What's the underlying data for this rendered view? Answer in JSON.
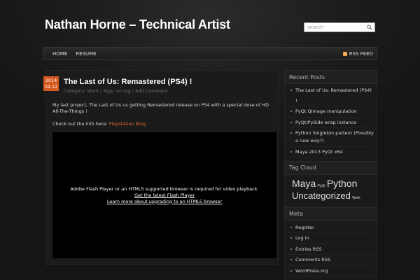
{
  "header": {
    "site_title": "Nathan Horne – Technical Artist",
    "search_placeholder": "search"
  },
  "nav": {
    "items": [
      {
        "label": "HOME"
      },
      {
        "label": "RESUME"
      }
    ],
    "rss_label": "RSS FEED"
  },
  "post": {
    "date_year": "2014",
    "date_day": "04.12",
    "title": "The Last of Us: Remastered (PS4) !",
    "meta_category_label": "Category:",
    "meta_category": "Work",
    "meta_tags": "/ Tags: no tag /",
    "meta_comment": "Add Comment",
    "paragraph1": "My last project, The Last of Us us getting Remastered release on PS4 with a special dose of HD All-The-Things !",
    "paragraph2_prefix": "Check out the info here:",
    "paragraph2_link": "Playstation Blog",
    "video": {
      "message": "Adobe Flash Player or an HTML5 supported browser is required for video playback.",
      "link1": "Get the latest Flash Player",
      "link2": "Learn more about upgrading to an HTML5 browser"
    }
  },
  "sidebar": {
    "recent_posts": {
      "title": "Recent Posts",
      "items": [
        "The Last of Us: Remastered (PS4) !",
        "PyQt QImage manipulation",
        "PyQt/PySide wrap instance",
        "Python Singleton pattern (Possibly a new way?)",
        "Maya 2013 PyQt x64"
      ]
    },
    "tag_cloud": {
      "title": "Tag Cloud",
      "tags": [
        "Maya",
        "PyQt",
        "Python",
        "Uncategorized",
        "Work"
      ]
    },
    "meta": {
      "title": "Meta",
      "items": [
        "Register",
        "Log in",
        "Entries RSS",
        "Comments RSS",
        "WordPress.org"
      ]
    }
  },
  "colors": {
    "accent_orange": "#d5581e",
    "link_orange": "#e2692a",
    "rss_orange": "#f28a1a",
    "background": "#1c1c1c"
  }
}
